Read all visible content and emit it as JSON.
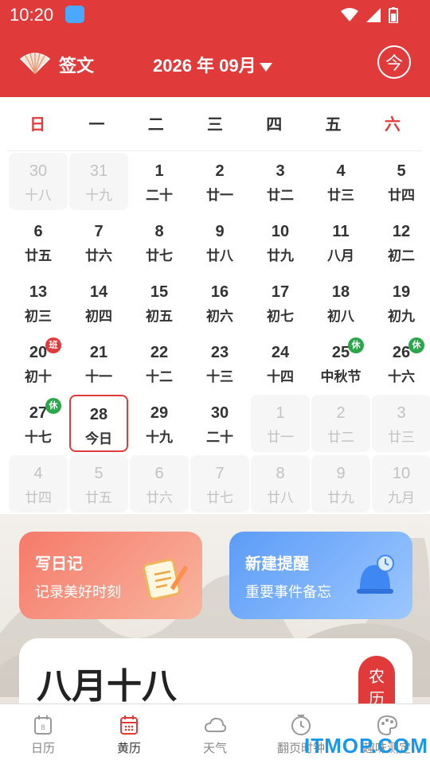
{
  "status_bar": {
    "time": "10:20"
  },
  "header": {
    "brand": "签文",
    "month": "2026 年 09月",
    "today_label": "今"
  },
  "weekdays": [
    "日",
    "一",
    "二",
    "三",
    "四",
    "五",
    "六"
  ],
  "calendar": [
    {
      "d": "30",
      "l": "十八",
      "other": true
    },
    {
      "d": "31",
      "l": "十九",
      "other": true
    },
    {
      "d": "1",
      "l": "二十"
    },
    {
      "d": "2",
      "l": "廿一"
    },
    {
      "d": "3",
      "l": "廿二"
    },
    {
      "d": "4",
      "l": "廿三"
    },
    {
      "d": "5",
      "l": "廿四"
    },
    {
      "d": "6",
      "l": "廿五"
    },
    {
      "d": "7",
      "l": "廿六"
    },
    {
      "d": "8",
      "l": "廿七"
    },
    {
      "d": "9",
      "l": "廿八"
    },
    {
      "d": "10",
      "l": "廿九"
    },
    {
      "d": "11",
      "l": "八月"
    },
    {
      "d": "12",
      "l": "初二"
    },
    {
      "d": "13",
      "l": "初三"
    },
    {
      "d": "14",
      "l": "初四"
    },
    {
      "d": "15",
      "l": "初五"
    },
    {
      "d": "16",
      "l": "初六"
    },
    {
      "d": "17",
      "l": "初七"
    },
    {
      "d": "18",
      "l": "初八"
    },
    {
      "d": "19",
      "l": "初九"
    },
    {
      "d": "20",
      "l": "初十",
      "badge": "班",
      "badge_type": "work"
    },
    {
      "d": "21",
      "l": "十一"
    },
    {
      "d": "22",
      "l": "十二"
    },
    {
      "d": "23",
      "l": "十三"
    },
    {
      "d": "24",
      "l": "十四"
    },
    {
      "d": "25",
      "l": "中秋节",
      "badge": "休",
      "badge_type": "rest"
    },
    {
      "d": "26",
      "l": "十六",
      "badge": "休",
      "badge_type": "rest"
    },
    {
      "d": "27",
      "l": "十七",
      "badge": "休",
      "badge_type": "rest"
    },
    {
      "d": "28",
      "l": "今日",
      "selected": true
    },
    {
      "d": "29",
      "l": "十九"
    },
    {
      "d": "30",
      "l": "二十"
    },
    {
      "d": "1",
      "l": "廿一",
      "other": true
    },
    {
      "d": "2",
      "l": "廿二",
      "other": true
    },
    {
      "d": "3",
      "l": "廿三",
      "other": true
    },
    {
      "d": "4",
      "l": "廿四",
      "other": true
    },
    {
      "d": "5",
      "l": "廿五",
      "other": true
    },
    {
      "d": "6",
      "l": "廿六",
      "other": true
    },
    {
      "d": "7",
      "l": "廿七",
      "other": true
    },
    {
      "d": "8",
      "l": "廿八",
      "other": true
    },
    {
      "d": "9",
      "l": "廿九",
      "other": true
    },
    {
      "d": "10",
      "l": "九月",
      "other": true
    }
  ],
  "cards": {
    "diary": {
      "title": "写日记",
      "subtitle": "记录美好时刻"
    },
    "remind": {
      "title": "新建提醒",
      "subtitle": "重要事件备忘"
    }
  },
  "lunar": {
    "date": "八月十八",
    "tag": "农历"
  },
  "tabs": [
    {
      "label": "日历",
      "icon": "calendar-icon"
    },
    {
      "label": "黄历",
      "icon": "almanac-icon",
      "active": true
    },
    {
      "label": "天气",
      "icon": "weather-icon"
    },
    {
      "label": "翻页时钟",
      "icon": "clock-icon"
    },
    {
      "label": "趣味测定",
      "icon": "palette-icon"
    }
  ],
  "watermark": "ITMOP.COM",
  "colors": {
    "brand_red": "#e03a3a",
    "rest_green": "#2aa74a"
  }
}
